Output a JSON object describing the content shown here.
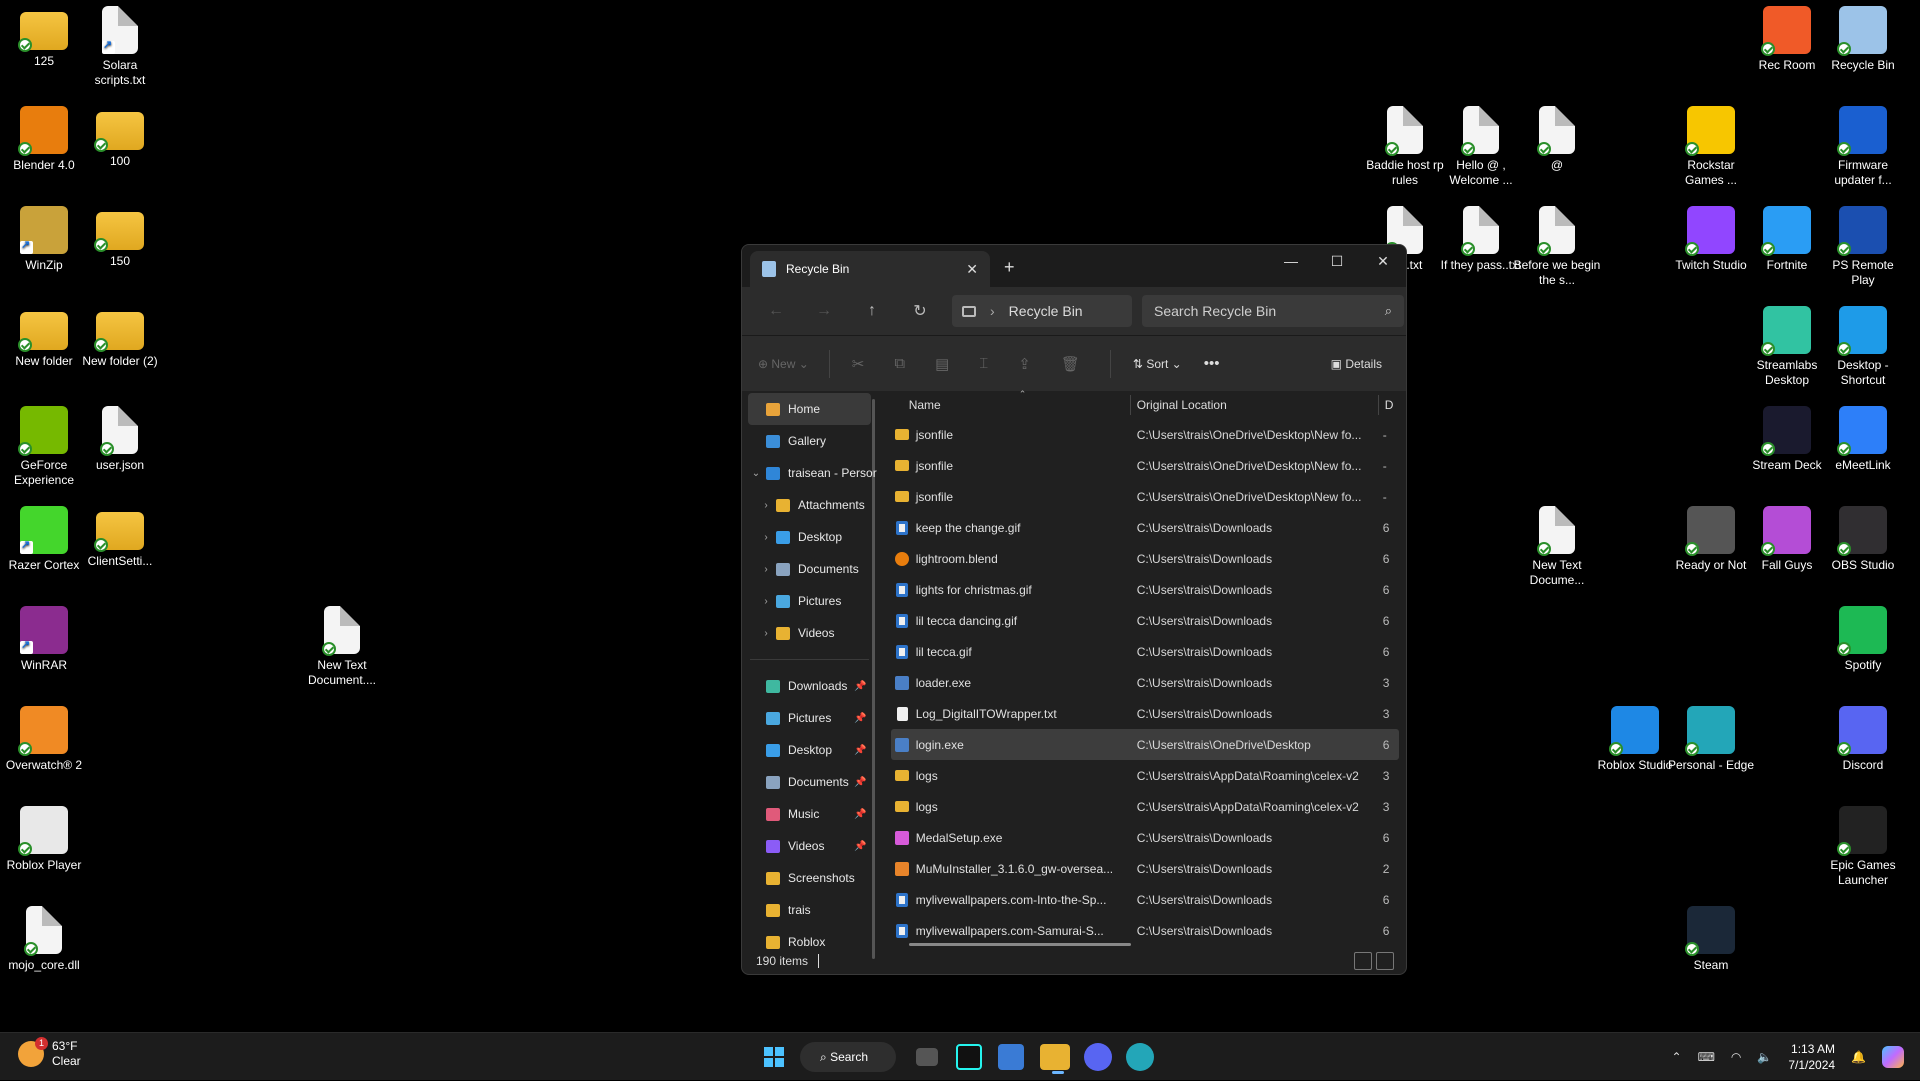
{
  "desktop": {
    "left_icons": [
      {
        "label": "125",
        "kind": "folder",
        "check": true
      },
      {
        "label": "Solara scripts.txt",
        "kind": "doc",
        "check": false
      },
      {
        "label": "Blender 4.0",
        "kind": "app",
        "color": "#e87d0d",
        "check": true
      },
      {
        "label": "100",
        "kind": "folder",
        "check": true
      },
      {
        "label": "WinZip",
        "kind": "app",
        "color": "#c9a23a",
        "check": false
      },
      {
        "label": "150",
        "kind": "folder",
        "check": true
      },
      {
        "label": "New folder",
        "kind": "folder",
        "check": true
      },
      {
        "label": "New folder (2)",
        "kind": "folder",
        "check": true
      },
      {
        "label": "GeForce Experience",
        "kind": "app",
        "color": "#76b900",
        "check": true
      },
      {
        "label": "user.json",
        "kind": "doc",
        "check": true
      },
      {
        "label": "Razer Cortex",
        "kind": "app",
        "color": "#44d62c",
        "check": false
      },
      {
        "label": "ClientSetti...",
        "kind": "folder",
        "check": true
      },
      {
        "label": "WinRAR",
        "kind": "app",
        "color": "#8b2c8f",
        "check": false
      },
      {
        "label": "New Text Document....",
        "kind": "doc",
        "check": true
      },
      {
        "label": "Overwatch® 2",
        "kind": "app",
        "color": "#f08a24",
        "check": true
      },
      {
        "label": "Roblox Player",
        "kind": "app",
        "color": "#e8e8e8",
        "check": true
      },
      {
        "label": "mojo_core.dll",
        "kind": "doc",
        "check": true
      }
    ],
    "right_icons": [
      {
        "label": "Rec Room",
        "kind": "app",
        "color": "#f05a28"
      },
      {
        "label": "Recycle Bin",
        "kind": "app",
        "color": "#9cc3e8"
      },
      {
        "label": "Baddie host rp rules",
        "kind": "doc"
      },
      {
        "label": "Hello @ , Welcome ...",
        "kind": "doc"
      },
      {
        "label": "@",
        "kind": "doc"
      },
      {
        "label": "Rockstar Games ...",
        "kind": "app",
        "color": "#f7c600"
      },
      {
        "label": "Firmware updater f...",
        "kind": "app",
        "color": "#1a5fd0"
      },
      {
        "label": "fail..txt",
        "kind": "doc"
      },
      {
        "label": "If they pass..txt",
        "kind": "doc"
      },
      {
        "label": "Before we begin the s...",
        "kind": "doc"
      },
      {
        "label": "Twitch Studio",
        "kind": "app",
        "color": "#9146ff"
      },
      {
        "label": "Fortnite",
        "kind": "app",
        "color": "#2a9df4"
      },
      {
        "label": "PS Remote Play",
        "kind": "app",
        "color": "#1b4fb0"
      },
      {
        "label": "Streamlabs Desktop",
        "kind": "app",
        "color": "#31c3a2"
      },
      {
        "label": "Desktop - Shortcut",
        "kind": "app",
        "color": "#1e9be8"
      },
      {
        "label": "Stream Deck",
        "kind": "app",
        "color": "#1a1a2e"
      },
      {
        "label": "eMeetLink",
        "kind": "app",
        "color": "#2d7ff9"
      },
      {
        "label": "New Text Docume...",
        "kind": "doc"
      },
      {
        "label": "Ready or Not",
        "kind": "app",
        "color": "#555555"
      },
      {
        "label": "Fall Guys",
        "kind": "app",
        "color": "#b44dd6"
      },
      {
        "label": "OBS Studio",
        "kind": "app",
        "color": "#302e31"
      },
      {
        "label": "Spotify",
        "kind": "app",
        "color": "#1db954"
      },
      {
        "label": "Roblox Studio",
        "kind": "app",
        "color": "#1e88e5"
      },
      {
        "label": "Personal - Edge",
        "kind": "app",
        "color": "#23a6b8"
      },
      {
        "label": "Discord",
        "kind": "app",
        "color": "#5865f2"
      },
      {
        "label": "Epic Games Launcher",
        "kind": "app",
        "color": "#222222"
      },
      {
        "label": "Steam",
        "kind": "app",
        "color": "#1b2838"
      }
    ]
  },
  "window": {
    "tab_title": "Recycle Bin",
    "breadcrumb": "Recycle Bin",
    "search_placeholder": "Search Recycle Bin",
    "toolbar": {
      "new": "New",
      "sort": "Sort",
      "details": "Details"
    },
    "nav": {
      "home": "Home",
      "gallery": "Gallery",
      "onedrive": "traisean - Persor",
      "od_children": [
        "Attachments",
        "Desktop",
        "Documents",
        "Pictures",
        "Videos"
      ],
      "quick": [
        "Downloads",
        "Pictures",
        "Desktop",
        "Documents",
        "Music",
        "Videos",
        "Screenshots",
        "trais",
        "Roblox"
      ]
    },
    "columns": {
      "name": "Name",
      "location": "Original Location",
      "extra": "D"
    },
    "rows": [
      {
        "name": "jsonfile",
        "loc": "C:\\Users\\trais\\OneDrive\\Desktop\\New fo...",
        "x": "-",
        "icon": "fold"
      },
      {
        "name": "jsonfile",
        "loc": "C:\\Users\\trais\\OneDrive\\Desktop\\New fo...",
        "x": "-",
        "icon": "fold"
      },
      {
        "name": "jsonfile",
        "loc": "C:\\Users\\trais\\OneDrive\\Desktop\\New fo...",
        "x": "-",
        "icon": "fold"
      },
      {
        "name": "keep the change.gif",
        "loc": "C:\\Users\\trais\\Downloads",
        "x": "6",
        "icon": "img"
      },
      {
        "name": "lightroom.blend",
        "loc": "C:\\Users\\trais\\Downloads",
        "x": "6",
        "icon": "blend"
      },
      {
        "name": "lights for christmas.gif",
        "loc": "C:\\Users\\trais\\Downloads",
        "x": "6",
        "icon": "img"
      },
      {
        "name": "lil tecca dancing.gif",
        "loc": "C:\\Users\\trais\\Downloads",
        "x": "6",
        "icon": "img"
      },
      {
        "name": "lil tecca.gif",
        "loc": "C:\\Users\\trais\\Downloads",
        "x": "6",
        "icon": "img"
      },
      {
        "name": "loader.exe",
        "loc": "C:\\Users\\trais\\Downloads",
        "x": "3",
        "icon": "exe"
      },
      {
        "name": "Log_DigitalITOWrapper.txt",
        "loc": "C:\\Users\\trais\\Downloads",
        "x": "3",
        "icon": "docf"
      },
      {
        "name": "login.exe",
        "loc": "C:\\Users\\trais\\OneDrive\\Desktop",
        "x": "6",
        "icon": "exe",
        "selected": true
      },
      {
        "name": "logs",
        "loc": "C:\\Users\\trais\\AppData\\Roaming\\celex-v2",
        "x": "3",
        "icon": "fold"
      },
      {
        "name": "logs",
        "loc": "C:\\Users\\trais\\AppData\\Roaming\\celex-v2",
        "x": "3",
        "icon": "fold"
      },
      {
        "name": "MedalSetup.exe",
        "loc": "C:\\Users\\trais\\Downloads",
        "x": "6",
        "icon": "medal"
      },
      {
        "name": "MuMuInstaller_3.1.6.0_gw-oversea...",
        "loc": "C:\\Users\\trais\\Downloads",
        "x": "2",
        "icon": "mumu"
      },
      {
        "name": "mylivewallpapers.com-Into-the-Sp...",
        "loc": "C:\\Users\\trais\\Downloads",
        "x": "6",
        "icon": "img"
      },
      {
        "name": "mylivewallpapers.com-Samurai-S...",
        "loc": "C:\\Users\\trais\\Downloads",
        "x": "6",
        "icon": "img"
      }
    ],
    "status": "190 items"
  },
  "taskbar": {
    "temp": "63°F",
    "weather": "Clear",
    "badge": "1",
    "search": "Search",
    "time": "1:13 AM",
    "date": "7/1/2024"
  }
}
